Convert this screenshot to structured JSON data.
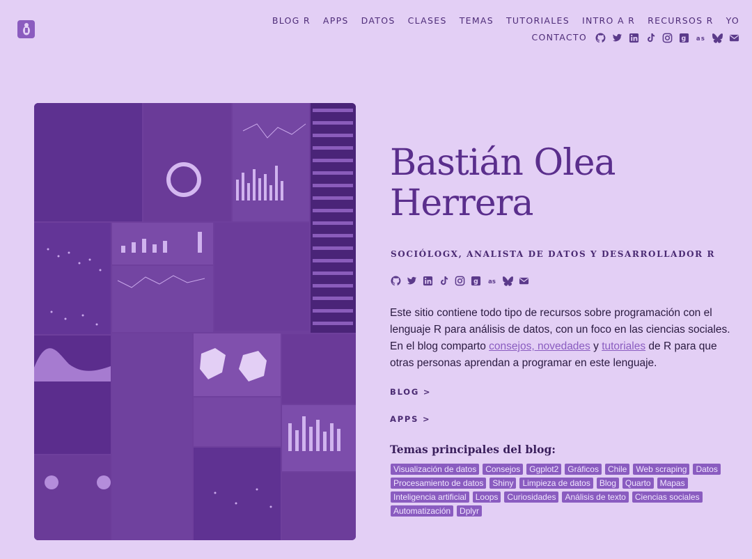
{
  "nav": {
    "row1": [
      "BLOG R",
      "APPS",
      "DATOS",
      "CLASES",
      "TEMAS",
      "TUTORIALES",
      "INTRO A R",
      "RECURSOS R",
      "YO"
    ],
    "row2_link": "CONTACTO",
    "icons": [
      "github-icon",
      "twitter-icon",
      "linkedin-icon",
      "tiktok-icon",
      "instagram-icon",
      "goodreads-icon",
      "lastfm-icon",
      "bluesky-icon",
      "email-icon"
    ]
  },
  "profile": {
    "name": "Bastián Olea Herrera",
    "subtitle": "SOCIÓLOGX, ANALISTA DE DATOS Y DESARROLLADOR R",
    "description_1": "Este sitio contiene todo tipo de recursos sobre programación con el lenguaje R para análisis de datos, con un foco en las ciencias sociales. En el blog comparto ",
    "link_consejos": "consejos, novedades",
    "description_y": " y ",
    "link_tutoriales": "tutoriales",
    "description_2": " de R para que otras personas aprendan a programar en este lenguaje."
  },
  "cta": {
    "blog": "BLOG >",
    "apps": "APPS >"
  },
  "topics": {
    "title": "Temas principales del blog:",
    "tags": [
      "Visualización de datos",
      "Consejos",
      "Ggplot2",
      "Gráficos",
      "Chile",
      "Web scraping",
      "Datos",
      "Procesamiento de datos",
      "Shiny",
      "Limpieza de datos",
      "Blog",
      "Quarto",
      "Mapas",
      "Inteligencia artificial",
      "Loops",
      "Curiosidades",
      "Análisis de texto",
      "Ciencias sociales",
      "Automatización",
      "Dplyr"
    ]
  },
  "colors": {
    "background": "#e3cff5",
    "accent": "#8a5cc0",
    "title": "#5a2e8c",
    "image_tint": "#6b3e9a"
  }
}
